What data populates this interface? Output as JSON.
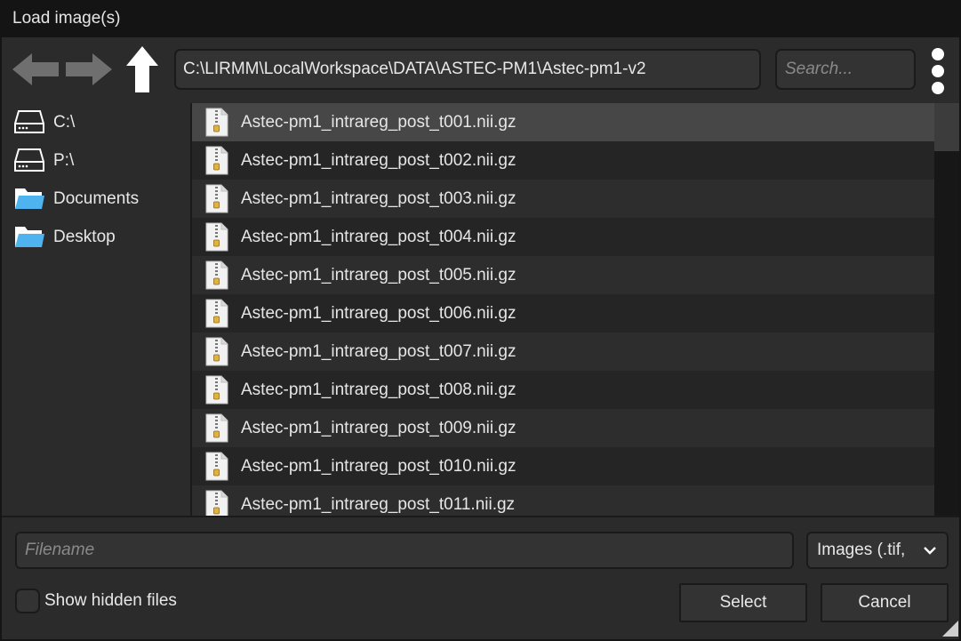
{
  "window": {
    "title": "Load image(s)"
  },
  "toolbar": {
    "path": "C:\\LIRMM\\LocalWorkspace\\DATA\\ASTEC-PM1\\Astec-pm1-v2",
    "search_placeholder": "Search...",
    "icons": {
      "back": "arrow-left-icon",
      "forward": "arrow-right-icon",
      "up": "arrow-up-icon",
      "more": "kebab-menu-icon"
    }
  },
  "sidebar": {
    "items": [
      {
        "label": "C:\\",
        "icon": "drive-icon"
      },
      {
        "label": "P:\\",
        "icon": "drive-icon"
      },
      {
        "label": "Documents",
        "icon": "folder-icon"
      },
      {
        "label": "Desktop",
        "icon": "folder-icon"
      }
    ]
  },
  "files": {
    "selected_index": 0,
    "items": [
      "Astec-pm1_intrareg_post_t001.nii.gz",
      "Astec-pm1_intrareg_post_t002.nii.gz",
      "Astec-pm1_intrareg_post_t003.nii.gz",
      "Astec-pm1_intrareg_post_t004.nii.gz",
      "Astec-pm1_intrareg_post_t005.nii.gz",
      "Astec-pm1_intrareg_post_t006.nii.gz",
      "Astec-pm1_intrareg_post_t007.nii.gz",
      "Astec-pm1_intrareg_post_t008.nii.gz",
      "Astec-pm1_intrareg_post_t009.nii.gz",
      "Astec-pm1_intrareg_post_t010.nii.gz",
      "Astec-pm1_intrareg_post_t011.nii.gz"
    ]
  },
  "footer": {
    "filename_placeholder": "Filename",
    "file_type": "Images (.tif,",
    "show_hidden_label": "Show hidden files",
    "select_label": "Select",
    "cancel_label": "Cancel"
  },
  "colors": {
    "accent_folder": "#4fb3f0",
    "selected_row": "#474747"
  }
}
